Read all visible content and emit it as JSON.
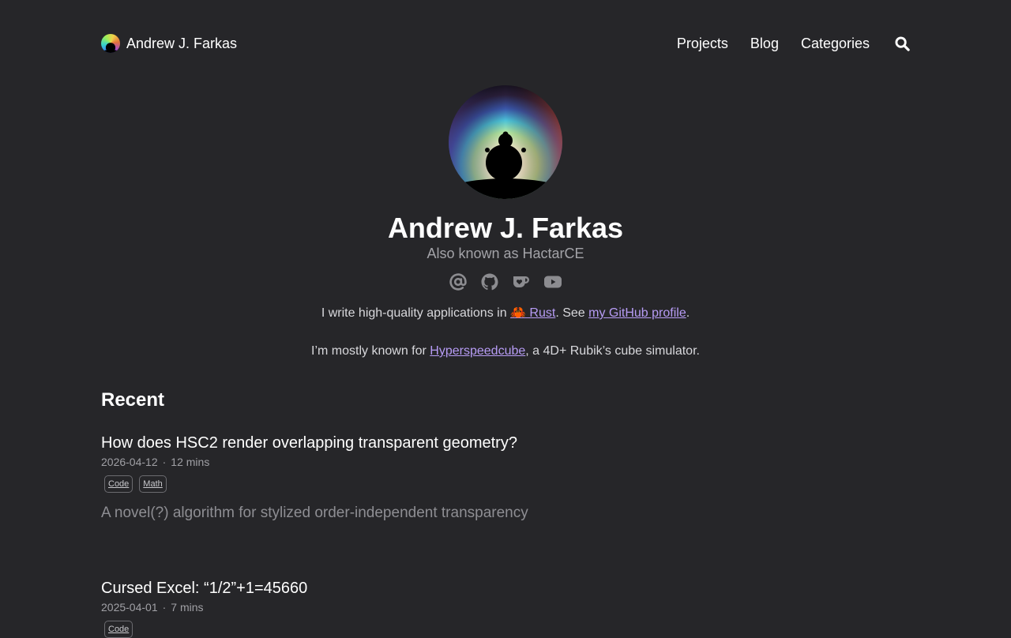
{
  "site": {
    "brand_name": "Andrew J. Farkas",
    "nav": [
      "Projects",
      "Blog",
      "Categories"
    ],
    "search_icon": "search-icon"
  },
  "profile": {
    "name": "Andrew J. Farkas",
    "alias": "Also known as HactarCE",
    "socials": [
      "email-icon",
      "github-icon",
      "kofi-icon",
      "youtube-icon"
    ],
    "bio_line1_pre": "I write high-quality applications in ",
    "bio_line1_emoji": "🦀",
    "bio_line1_link": " Rust",
    "bio_line1_mid": ". See ",
    "bio_line1_link2": "my GitHub profile",
    "bio_line1_end": ".",
    "bio_line2_pre": "I’m mostly known for ",
    "bio_line2_link": "Hyperspeedcube",
    "bio_line2_post": ", a 4D+ Rubik’s cube simulator."
  },
  "recent": {
    "heading": "Recent",
    "posts": [
      {
        "title": "How does HSC2 render overlapping transparent geometry?",
        "date": "2026-04-12",
        "sep": "·",
        "read_time": "12 mins",
        "tags": [
          "Code",
          "Math"
        ],
        "summary": "A novel(?) algorithm for stylized order-independent transparency"
      },
      {
        "title": "Cursed Excel: “1/2”+1=45660",
        "date": "2025-04-01",
        "sep": "·",
        "read_time": "7 mins",
        "tags": [
          "Code"
        ]
      }
    ]
  },
  "colors": {
    "background": "#262629",
    "link": "#b79cf5",
    "muted": "#8e8e93"
  }
}
